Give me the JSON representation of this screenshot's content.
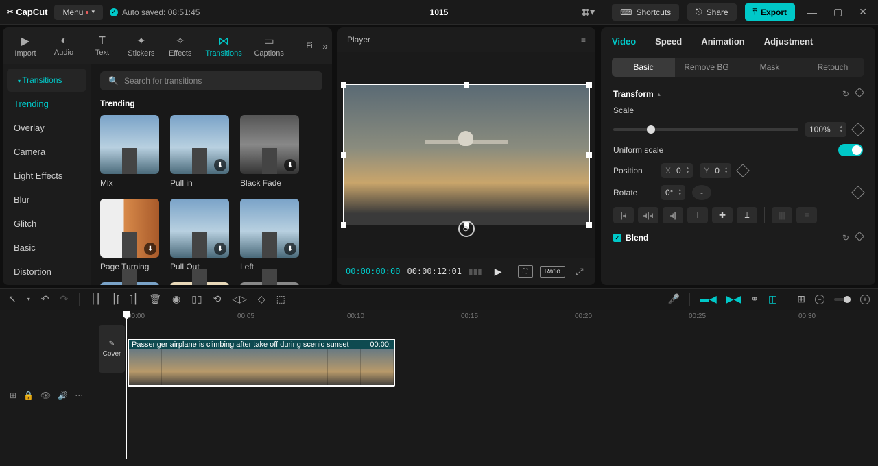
{
  "app": {
    "logo": "CapCut",
    "menu": "Menu",
    "autosave": "Auto saved: 08:51:45",
    "project": "1015"
  },
  "topbar": {
    "shortcuts": "Shortcuts",
    "share": "Share",
    "export": "Export"
  },
  "mediaTabs": {
    "import": "Import",
    "audio": "Audio",
    "text": "Text",
    "stickers": "Stickers",
    "effects": "Effects",
    "transitions": "Transitions",
    "captions": "Captions",
    "filters": "Fi"
  },
  "sideHead": "Transitions",
  "sideCats": {
    "trending": "Trending",
    "overlay": "Overlay",
    "camera": "Camera",
    "light": "Light Effects",
    "blur": "Blur",
    "glitch": "Glitch",
    "basic": "Basic",
    "distortion": "Distortion"
  },
  "search": {
    "placeholder": "Search for transitions"
  },
  "browser": {
    "section": "Trending",
    "items": {
      "mix": "Mix",
      "pullin": "Pull in",
      "blackfade": "Black Fade",
      "pageturning": "Page Turning",
      "pullout": "Pull Out",
      "left": "Left"
    }
  },
  "player": {
    "title": "Player",
    "current": "00:00:00:00",
    "total": "00:00:12:01",
    "ratio": "Ratio"
  },
  "inspector": {
    "tabs": {
      "video": "Video",
      "speed": "Speed",
      "animation": "Animation",
      "adjustment": "Adjustment"
    },
    "subs": {
      "basic": "Basic",
      "removebg": "Remove BG",
      "mask": "Mask",
      "retouch": "Retouch"
    },
    "transform": "Transform",
    "scale": "Scale",
    "scaleVal": "100%",
    "uniform": "Uniform scale",
    "position": "Position",
    "x": "X",
    "xval": "0",
    "y": "Y",
    "yval": "0",
    "rotate": "Rotate",
    "rotateVal": "0°",
    "rotateFlag": "-",
    "blend": "Blend"
  },
  "ruler": {
    "t0": "00:00",
    "t5": "00:05",
    "t10": "00:10",
    "t15": "00:15",
    "t20": "00:20",
    "t25": "00:25",
    "t30": "00:30"
  },
  "clip": {
    "title": "Passenger airplane is climbing after take off during scenic sunset",
    "dur": "00:00:"
  },
  "cover": "Cover"
}
